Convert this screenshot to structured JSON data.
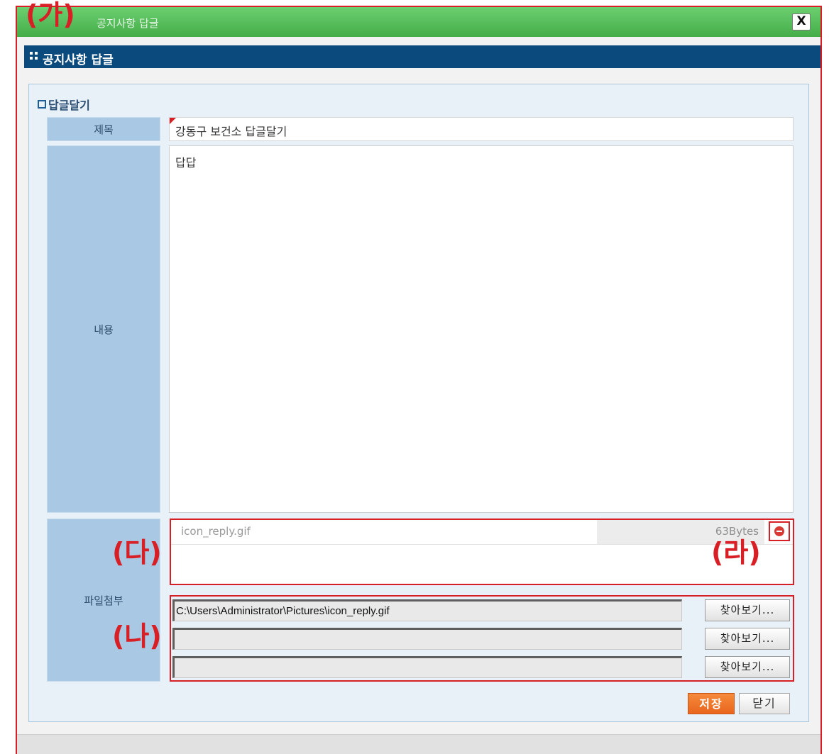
{
  "window": {
    "title": "공지사항 답글",
    "close_label": "X"
  },
  "header": {
    "title": "공지사항 답글"
  },
  "section": {
    "title": "답글달기"
  },
  "form": {
    "subject_label": "제목",
    "subject_value": "강동구 보건소 답글달기",
    "content_label": "내용",
    "content_value": "답답",
    "attach_label": "파일첨부"
  },
  "attachments": {
    "existing": [
      {
        "name": "icon_reply.gif",
        "size": "63Bytes"
      }
    ],
    "inputs": [
      {
        "value": "C:\\Users\\Administrator\\Pictures\\icon_reply.gif",
        "button": "찾아보기..."
      },
      {
        "value": "",
        "button": "찾아보기..."
      },
      {
        "value": "",
        "button": "찾아보기..."
      }
    ]
  },
  "buttons": {
    "save": "저장",
    "close": "닫기"
  },
  "annotations": {
    "ga": "(가)",
    "na": "(나)",
    "da": "(다)",
    "ra": "(라)"
  },
  "colors": {
    "titlebar": "#45ad4a",
    "header": "#0a4a7d",
    "annotation": "#d81f26",
    "save_button": "#e9651d"
  }
}
